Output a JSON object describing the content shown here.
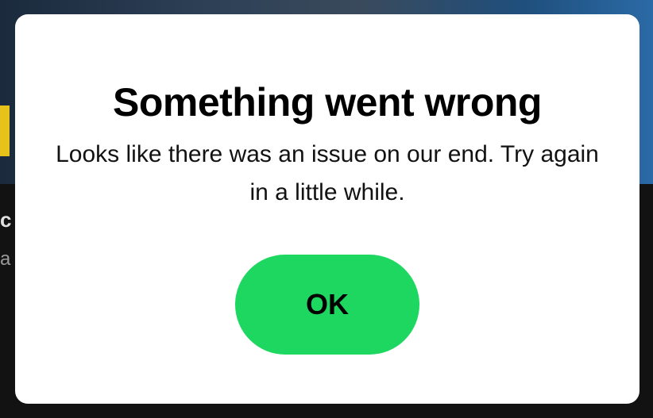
{
  "dialog": {
    "title": "Something went wrong",
    "message": "Looks like there was an issue on our end. Try again in a little while.",
    "ok_label": "OK"
  },
  "background": {
    "partial_title": "c",
    "partial_subtitle": "a"
  },
  "colors": {
    "accent": "#1ed760",
    "dialog_bg": "#ffffff",
    "page_bg": "#121212"
  }
}
